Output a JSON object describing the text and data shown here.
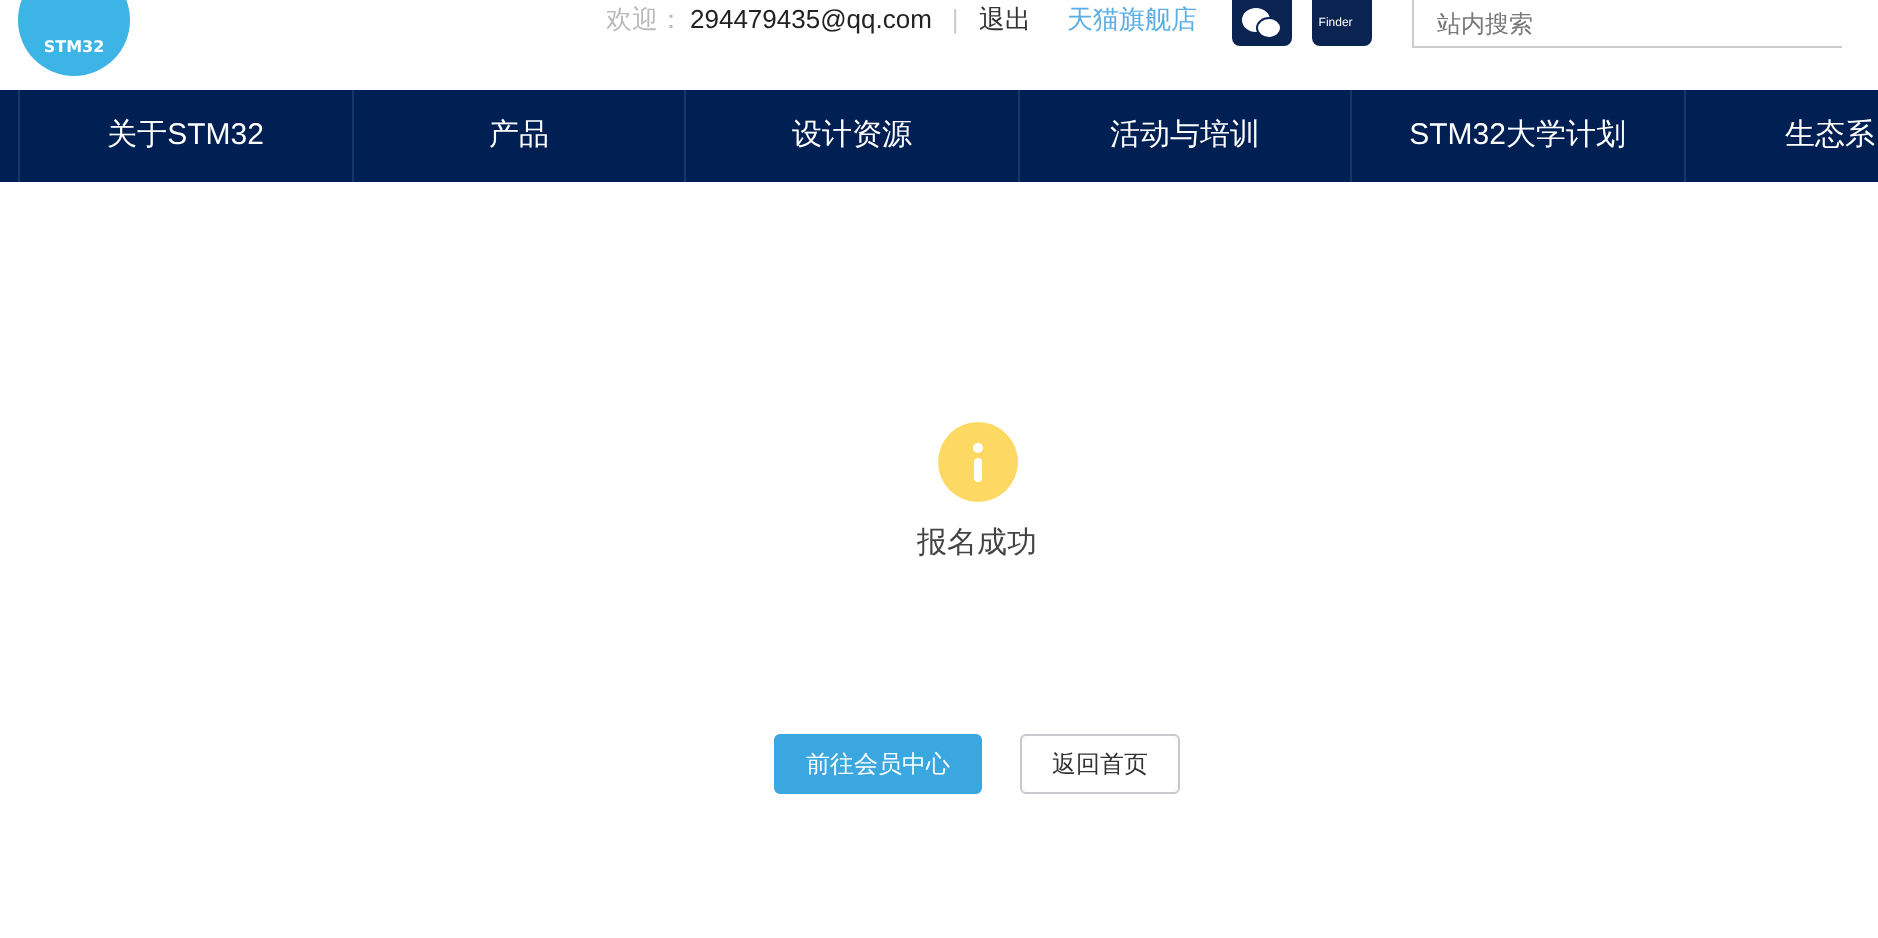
{
  "header": {
    "logo_text": "STM32",
    "welcome_label": "欢迎：",
    "user_email": "294479435@qq.com",
    "separator": "|",
    "logout": "退出",
    "store_link": "天猫旗舰店",
    "finder_label": "Finder",
    "search": {
      "placeholder": "站内搜索"
    }
  },
  "nav": [
    {
      "label": "关于STM32"
    },
    {
      "label": "产品"
    },
    {
      "label": "设计资源"
    },
    {
      "label": "活动与培训"
    },
    {
      "label": "STM32大学计划"
    },
    {
      "label": "生态系"
    }
  ],
  "result": {
    "message": "报名成功",
    "buttons": [
      {
        "label": "前往会员中心",
        "kind": "primary"
      },
      {
        "label": "返回首页",
        "kind": "outline"
      }
    ]
  }
}
